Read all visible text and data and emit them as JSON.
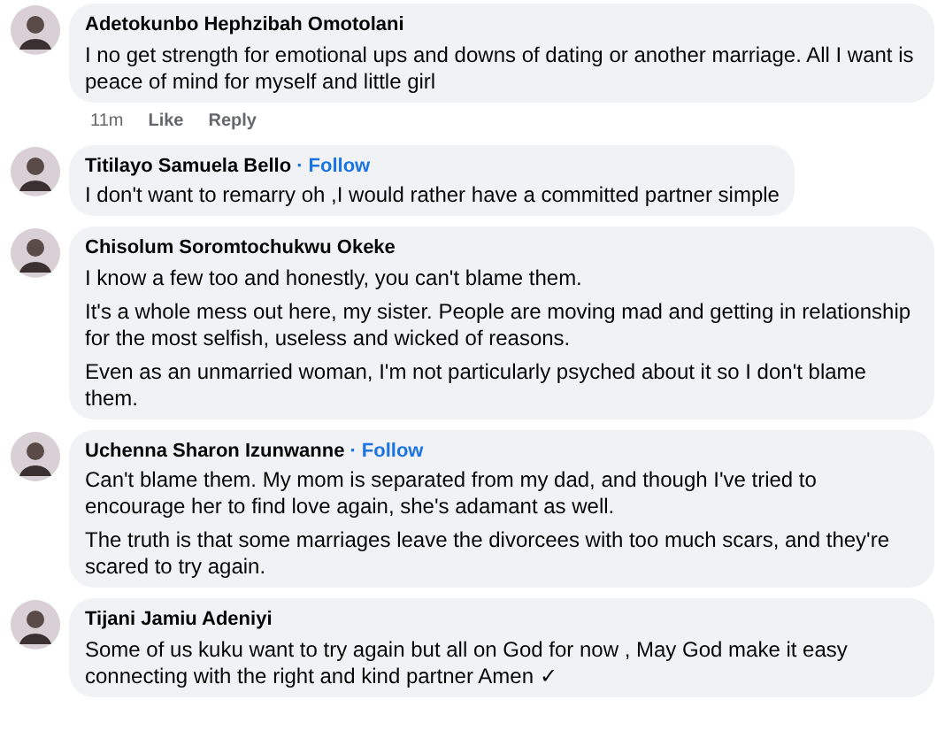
{
  "comments": [
    {
      "author": "Adetokunbo Hephzibah Omotolani",
      "paragraphs": [
        "I no get strength for emotional ups and downs of dating or another marriage. All I want is peace of mind for myself and little girl"
      ],
      "meta": {
        "time": "11m",
        "like": "Like",
        "reply": "Reply"
      }
    },
    {
      "author": "Titilayo Samuela Bello",
      "follow": "· Follow",
      "paragraphs": [
        "I don't want to remarry oh ,I would rather have a committed partner simple"
      ]
    },
    {
      "author": "Chisolum Soromtochukwu Okeke",
      "paragraphs": [
        "I know a few too and honestly, you can't blame them.",
        "It's a whole mess out here, my sister. People are moving mad and getting in relationship for the most selfish, useless and wicked of reasons.",
        "Even as an unmarried woman, I'm not particularly psyched about it so I don't blame them."
      ]
    },
    {
      "author": "Uchenna Sharon Izunwanne",
      "follow": "· Follow",
      "paragraphs": [
        "Can't blame them. My mom is separated from my dad, and though I've tried to encourage her to find love again, she's adamant as well.",
        "The truth is that some marriages leave the divorcees with too much scars, and they're scared to try again."
      ]
    },
    {
      "author": "Tijani Jamiu Adeniyi",
      "paragraphs": [
        "Some of us kuku want to try again but all on God for now , May God make it easy connecting with the right and kind partner Amen ✓"
      ]
    }
  ]
}
